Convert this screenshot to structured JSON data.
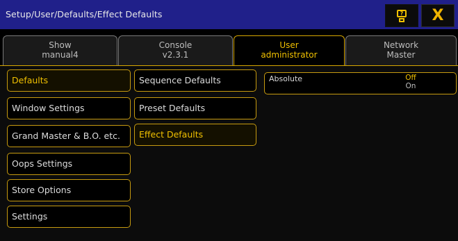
{
  "title": "Setup/User/Defaults/Effect Defaults",
  "titlebar": {
    "help_icon": "help-icon",
    "close_icon": "close-icon",
    "help_glyph": "?",
    "close_glyph": "X",
    "accent_color": "#f0c000",
    "bar_color": "#20208a"
  },
  "tabs": [
    {
      "line1": "Show",
      "line2": "manual4",
      "active": false
    },
    {
      "line1": "Console",
      "line2": "v2.3.1",
      "active": false
    },
    {
      "line1": "User",
      "line2": "administrator",
      "active": true
    },
    {
      "line1": "Network",
      "line2": "Master",
      "active": false
    }
  ],
  "menu_left": [
    {
      "label": "Defaults",
      "selected": true
    },
    {
      "label": "Window Settings",
      "selected": false
    },
    {
      "label": "Grand Master & B.O. etc.",
      "selected": false
    },
    {
      "label": "Oops Settings",
      "selected": false
    },
    {
      "label": "Store Options",
      "selected": false
    },
    {
      "label": "Settings",
      "selected": false
    }
  ],
  "menu_middle": [
    {
      "label": "Sequence Defaults",
      "selected": false
    },
    {
      "label": "Preset Defaults",
      "selected": false
    },
    {
      "label": "Effect Defaults",
      "selected": true
    }
  ],
  "setting": {
    "label": "Absolute",
    "value_top": "Off",
    "value_bottom": "On",
    "current": "Off"
  }
}
